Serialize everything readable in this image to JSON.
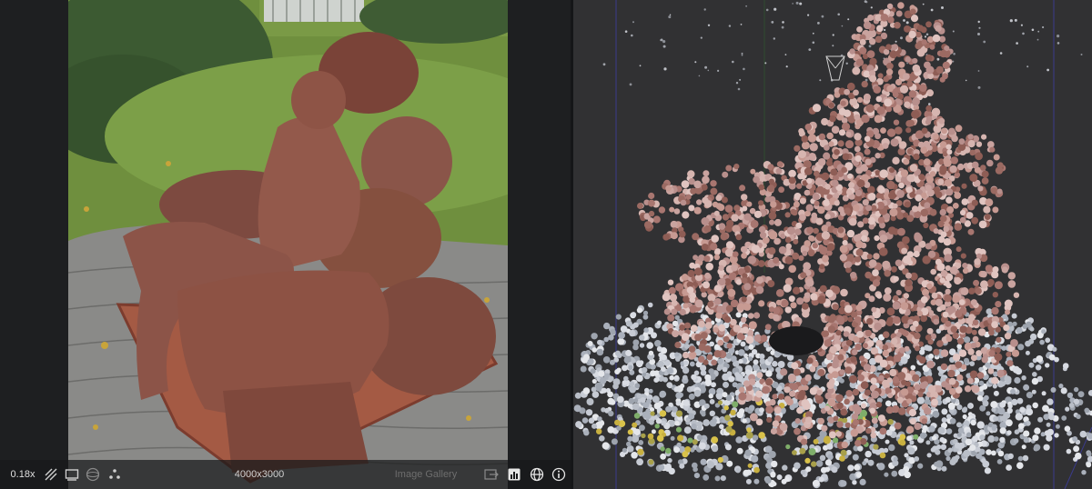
{
  "image_viewer": {
    "zoom_label": "0.18x",
    "resolution_label": "4000x3000",
    "gallery_label": "Image Gallery",
    "toolbar_icons": [
      "hatch-pattern-icon",
      "frame-icon",
      "sphere-icon",
      "points-icon"
    ],
    "right_icons": [
      "import-icon",
      "bar-chart-icon",
      "globe-icon",
      "info-icon"
    ]
  },
  "viewport": {
    "background_color": "#313133",
    "camera_marker_color": "#cfcfcf",
    "axis_line_color": "#3b3b8c"
  },
  "colors": {
    "toolbar_bg": "#18191b",
    "grass": "#6a8a3c",
    "statue": "#8a5248",
    "cobblestone": "#8c8c8c",
    "brick": "#a85a44"
  }
}
